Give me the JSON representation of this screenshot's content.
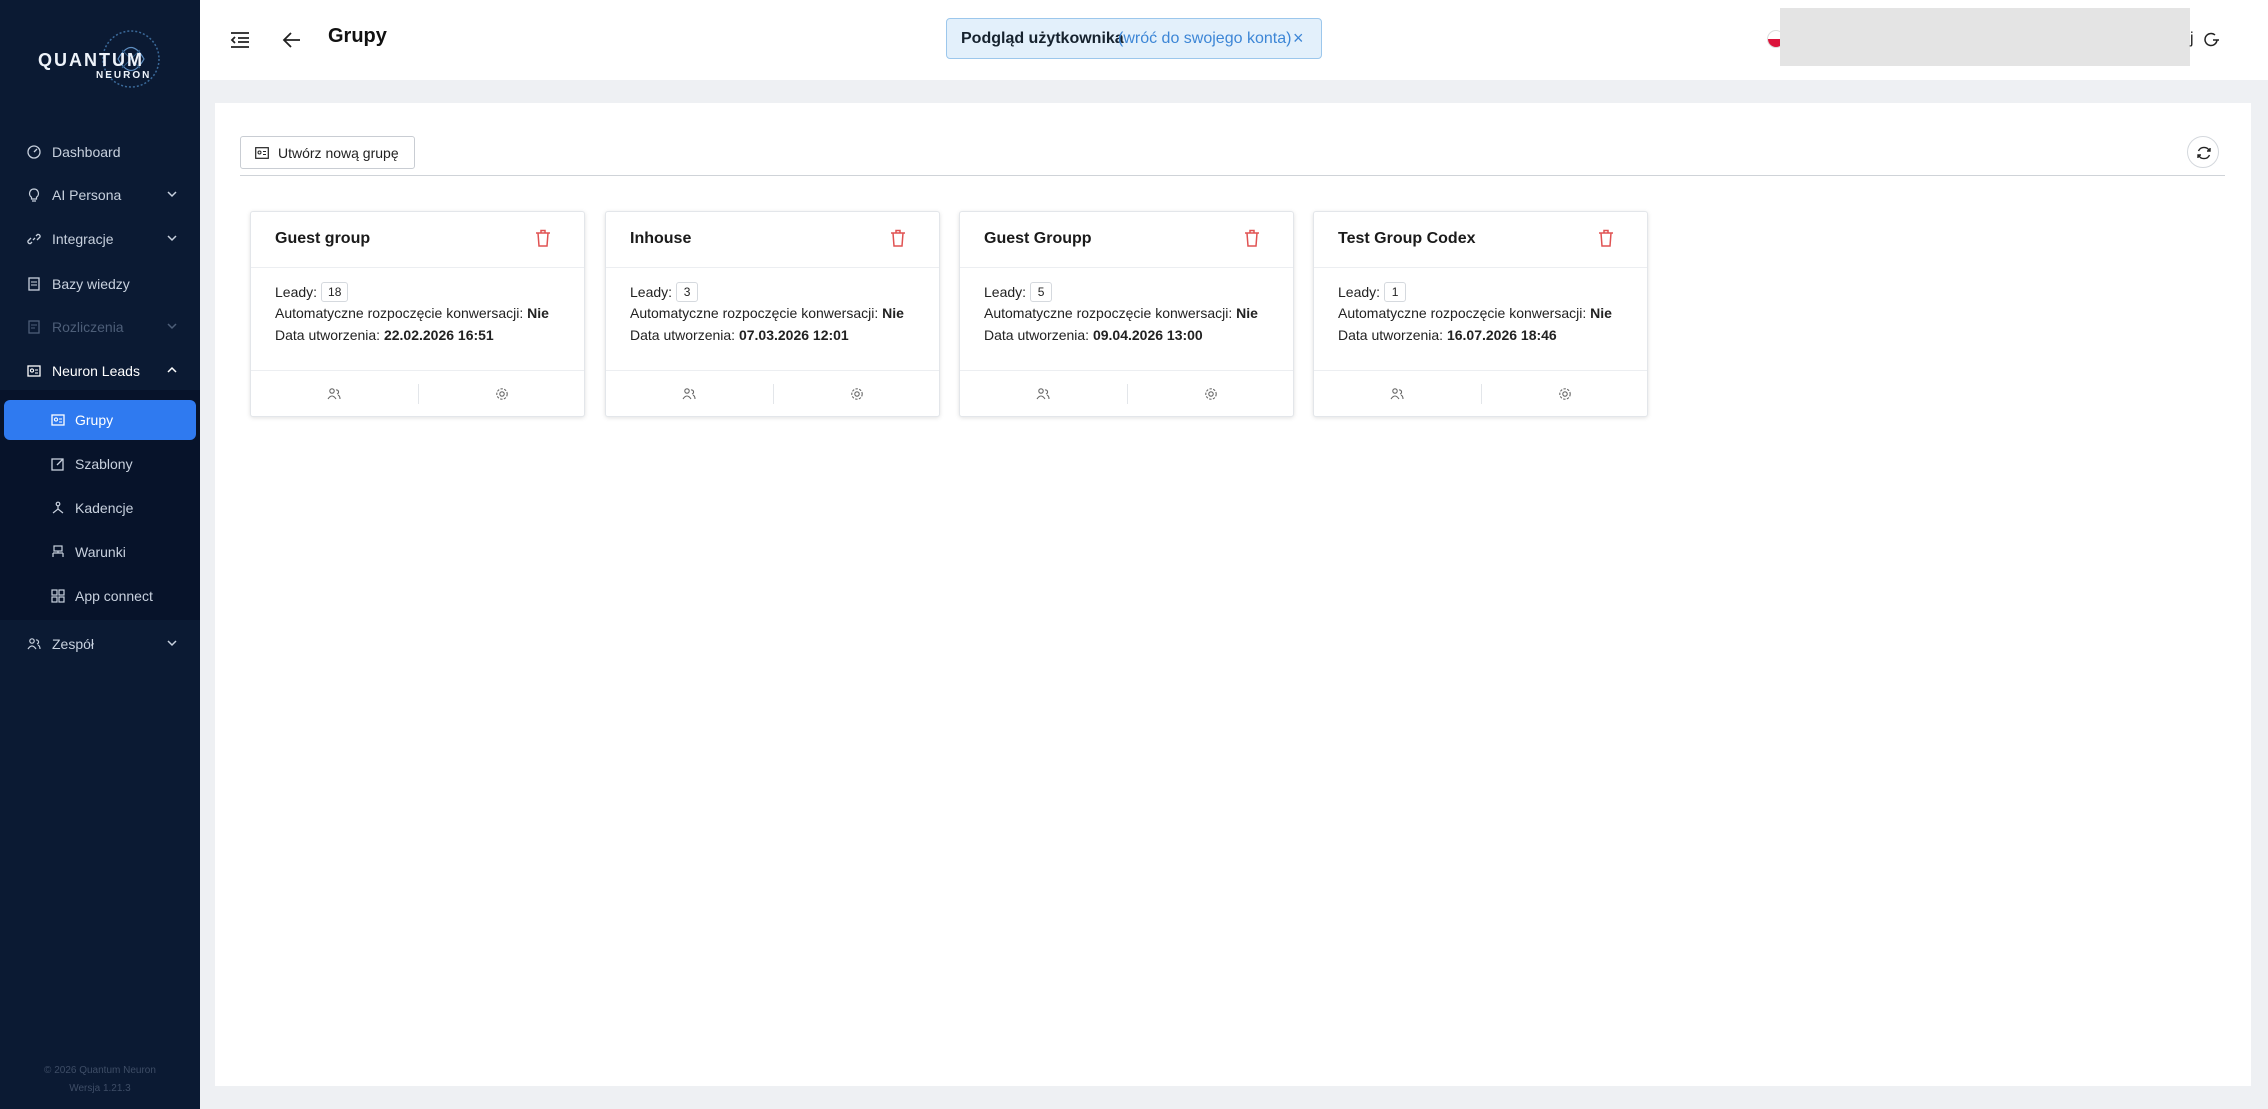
{
  "brand": {
    "logo_main": "QUANTUM",
    "logo_sub": "NEURON"
  },
  "sidebar": {
    "items": [
      {
        "label": "Dashboard",
        "icon": "dashboard-icon"
      },
      {
        "label": "AI Persona",
        "icon": "lightbulb-icon"
      },
      {
        "label": "Integracje",
        "icon": "link-icon"
      },
      {
        "label": "Bazy wiedzy",
        "icon": "book-icon"
      },
      {
        "label": "Rozliczenia",
        "icon": "receipt-icon"
      },
      {
        "label": "Neuron Leads",
        "icon": "id-card-icon"
      },
      {
        "label": "Zespół",
        "icon": "team-icon"
      }
    ],
    "subitems": [
      {
        "label": "Grupy",
        "icon": "group-icon"
      },
      {
        "label": "Szablony",
        "icon": "edit-icon"
      },
      {
        "label": "Kadencje",
        "icon": "cadence-icon"
      },
      {
        "label": "Warunki",
        "icon": "conditions-icon"
      },
      {
        "label": "App connect",
        "icon": "apps-icon"
      }
    ],
    "footer_copyright": "© 2026 Quantum Neuron",
    "footer_version": "Wersja 1.21.3"
  },
  "topbar": {
    "title": "Grupy",
    "impersonation_label": "Podgląd użytkownika",
    "impersonation_link": "(wróć do swojego konta)",
    "impersonation_close": "×",
    "tail_text": "j"
  },
  "toolbar": {
    "create_label": "Utwórz nową grupę"
  },
  "labels": {
    "leads": "Leady:",
    "auto_start": "Automatyczne rozpoczęcie konwersacji:",
    "created": "Data utworzenia:"
  },
  "groups": [
    {
      "name": "Guest group",
      "leads": "18",
      "auto_start": "Nie",
      "created": "22.02.2026 16:51"
    },
    {
      "name": "Inhouse",
      "leads": "3",
      "auto_start": "Nie",
      "created": "07.03.2026 12:01"
    },
    {
      "name": "Guest Groupp",
      "leads": "5",
      "auto_start": "Nie",
      "created": "09.04.2026 13:00"
    },
    {
      "name": "Test Group Codex",
      "leads": "1",
      "auto_start": "Nie",
      "created": "16.07.2026 18:46"
    }
  ],
  "colors": {
    "sidebar_bg": "#0b1a33",
    "accent": "#2f7af0",
    "danger": "#e05252",
    "info_bg": "#e3f0fb"
  }
}
